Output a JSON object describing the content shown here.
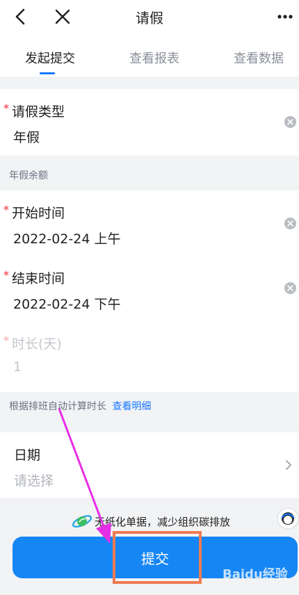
{
  "header": {
    "back_icon": "chevron-left-icon",
    "close_icon": "close-icon",
    "title": "请假",
    "more_icon": "more-dots-icon"
  },
  "tabs": [
    {
      "label": "发起提交",
      "active": true
    },
    {
      "label": "查看报表",
      "active": false
    },
    {
      "label": "查看数据",
      "active": false
    }
  ],
  "form": {
    "leave_type": {
      "label": "请假类型",
      "value": "年假",
      "required": true
    },
    "leave_balance_hint": "年假余额",
    "start_time": {
      "label": "开始时间",
      "value": "2022-02-24 上午",
      "required": true
    },
    "end_time": {
      "label": "结束时间",
      "value": "2022-02-24 下午",
      "required": true
    },
    "duration": {
      "label": "时长(天)",
      "value": "1",
      "required": true
    },
    "duration_hint": "根据排班自动计算时长",
    "duration_detail_link": "查看明细",
    "date": {
      "label": "日期",
      "placeholder": "请选择"
    }
  },
  "footer": {
    "note": "无纸化单据，减少组织碳排放",
    "submit_label": "提交"
  },
  "watermark": "Baidu经验",
  "colors": {
    "accent": "#1677ff",
    "submit": "#1686f5",
    "required": "#f5222d",
    "annotation_arrow": "#e62ee6",
    "annotation_box": "#f07a52"
  }
}
